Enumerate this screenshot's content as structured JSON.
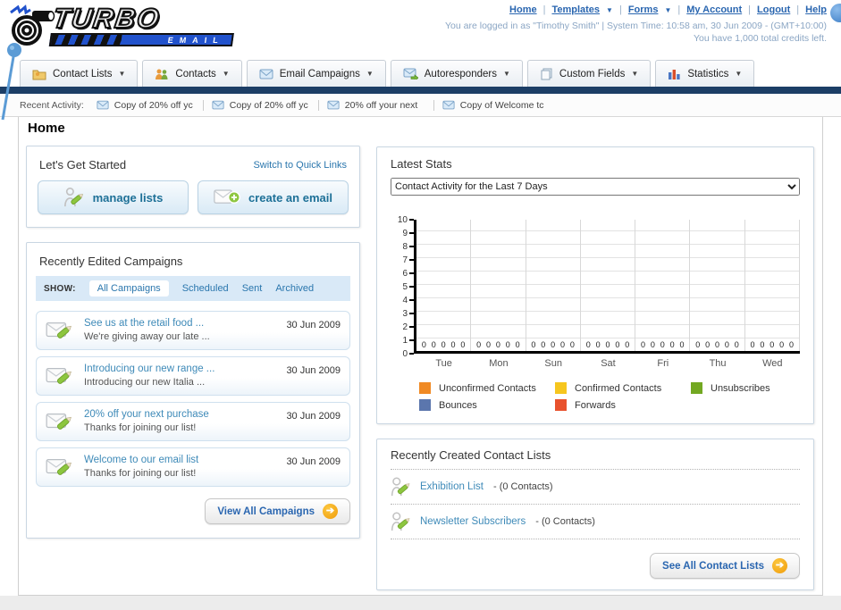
{
  "header": {
    "logo_title": "TURBO",
    "logo_subtitle": "EMAIL",
    "separator": "|",
    "nav_links": [
      {
        "label": "Home",
        "dropdown": false
      },
      {
        "label": "Templates",
        "dropdown": true
      },
      {
        "label": "Forms",
        "dropdown": true
      },
      {
        "label": "My Account",
        "dropdown": false
      },
      {
        "label": "Logout",
        "dropdown": false
      },
      {
        "label": "Help",
        "dropdown": false
      }
    ],
    "login_info": "You are logged in as \"Timothy Smith\" | System Time: 10:58 am, 30 Jun 2009 - (GMT+10:00)",
    "credits_info": "You have 1,000 total credits left."
  },
  "nav_tabs": [
    {
      "label": "Contact Lists",
      "icon": "folder-icon"
    },
    {
      "label": "Contacts",
      "icon": "contacts-icon"
    },
    {
      "label": "Email Campaigns",
      "icon": "envelope-icon"
    },
    {
      "label": "Autoresponders",
      "icon": "envelope-go-icon"
    },
    {
      "label": "Custom Fields",
      "icon": "pages-icon"
    },
    {
      "label": "Statistics",
      "icon": "bar-chart-icon"
    }
  ],
  "recent_activity": {
    "label": "Recent Activity:",
    "items": [
      "Copy of 20% off yc",
      "Copy of 20% off yc",
      "20% off your next ",
      "Copy of Welcome tc"
    ]
  },
  "page_title": "Home",
  "get_started": {
    "title": "Let's Get Started",
    "switch_link": "Switch to Quick Links",
    "buttons": [
      {
        "label": "manage lists"
      },
      {
        "label": "create an email"
      }
    ]
  },
  "campaigns": {
    "title": "Recently Edited Campaigns",
    "show_label": "SHOW:",
    "filters": [
      {
        "label": "All Campaigns",
        "active": true
      },
      {
        "label": "Scheduled",
        "active": false
      },
      {
        "label": "Sent",
        "active": false
      },
      {
        "label": "Archived",
        "active": false
      }
    ],
    "items": [
      {
        "title": "See us at the retail food ...",
        "subtitle": "We're giving away our late ...",
        "date": "30 Jun 2009"
      },
      {
        "title": "Introducing our new range ...",
        "subtitle": "Introducing our new Italia ...",
        "date": "30 Jun 2009"
      },
      {
        "title": "20% off your next purchase",
        "subtitle": "Thanks for joining our list!",
        "date": "30 Jun 2009"
      },
      {
        "title": "Welcome to our email list",
        "subtitle": "Thanks for joining our list!",
        "date": "30 Jun 2009"
      }
    ],
    "view_all_label": "View All Campaigns"
  },
  "latest_stats": {
    "title": "Latest Stats",
    "selected_option": "Contact Activity for the Last 7 Days"
  },
  "chart_data": {
    "type": "bar",
    "title": "Contact Activity for the Last 7 Days",
    "categories": [
      "Tue",
      "Mon",
      "Sun",
      "Sat",
      "Fri",
      "Thu",
      "Wed"
    ],
    "series": [
      {
        "name": "Unconfirmed Contacts",
        "color": "#f08a24",
        "values": [
          0,
          0,
          0,
          0,
          0,
          0,
          0
        ]
      },
      {
        "name": "Confirmed Contacts",
        "color": "#f6c61e",
        "values": [
          0,
          0,
          0,
          0,
          0,
          0,
          0
        ]
      },
      {
        "name": "Unsubscribes",
        "color": "#73a822",
        "values": [
          0,
          0,
          0,
          0,
          0,
          0,
          0
        ]
      },
      {
        "name": "Bounces",
        "color": "#5b76ad",
        "values": [
          0,
          0,
          0,
          0,
          0,
          0,
          0
        ]
      },
      {
        "name": "Forwards",
        "color": "#e8512d",
        "values": [
          0,
          0,
          0,
          0,
          0,
          0,
          0
        ]
      }
    ],
    "ylim": [
      0,
      10
    ],
    "ytick_step": 1,
    "grid": true,
    "legend_position": "bottom"
  },
  "contact_lists": {
    "title": "Recently Created Contact Lists",
    "items": [
      {
        "name": "Exhibition List",
        "detail": "- (0 Contacts)"
      },
      {
        "name": "Newsletter Subscribers",
        "detail": "- (0 Contacts)"
      }
    ],
    "see_all_label": "See All Contact Lists"
  }
}
